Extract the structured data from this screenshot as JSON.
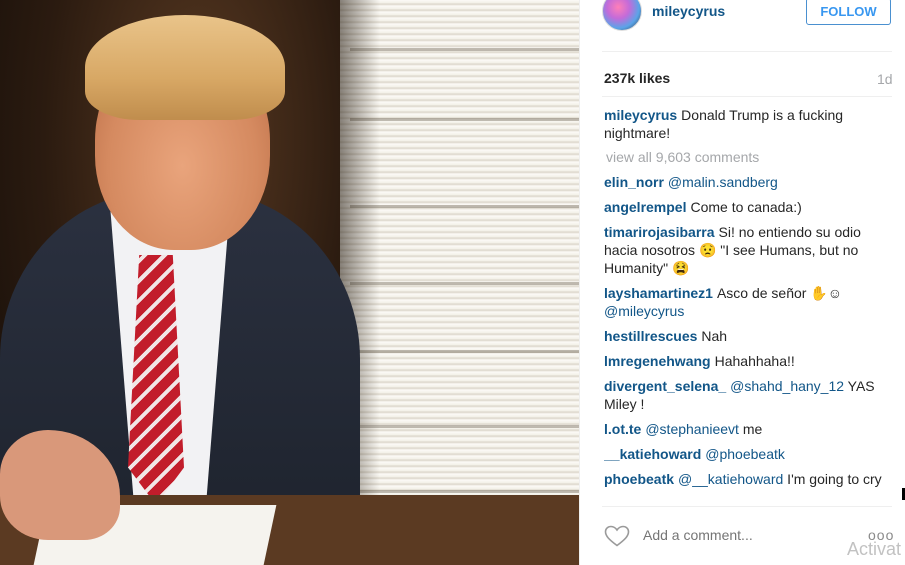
{
  "post": {
    "username": "mileycyrus",
    "follow_label": "FOLLOW",
    "likes": "237k likes",
    "age": "1d",
    "caption": {
      "author": "mileycyrus",
      "text": "Donald Trump is a fucking nightmare!"
    },
    "view_all": "view all 9,603 comments"
  },
  "comments": [
    {
      "author": "elin_norr",
      "parts": [
        {
          "text": "@malin.sandberg",
          "mention": true
        }
      ]
    },
    {
      "author": "angelrempel",
      "parts": [
        {
          "text": "Come to canada:)",
          "mention": false
        }
      ]
    },
    {
      "author": "timarirojasibarra",
      "parts": [
        {
          "text": "Si! no entiendo su odio hacia nosotros 😟 \"I see Humans, but no Humanity\" 😫",
          "mention": false
        }
      ]
    },
    {
      "author": "layshamartinez1",
      "parts": [
        {
          "text": "Asco de señor ✋☺ ",
          "mention": false
        },
        {
          "text": "@mileycyrus",
          "mention": true
        }
      ]
    },
    {
      "author": "hestillrescues",
      "parts": [
        {
          "text": "Nah",
          "mention": false
        }
      ]
    },
    {
      "author": "lmregenehwang",
      "parts": [
        {
          "text": "Hahahhaha!!",
          "mention": false
        }
      ]
    },
    {
      "author": "divergent_selena_",
      "parts": [
        {
          "text": "@shahd_hany_12",
          "mention": true
        },
        {
          "text": " YAS Miley !",
          "mention": false
        }
      ]
    },
    {
      "author": "l.ot.te",
      "parts": [
        {
          "text": "@stephanieevt",
          "mention": true
        },
        {
          "text": " me",
          "mention": false
        }
      ]
    },
    {
      "author": "__katiehoward",
      "parts": [
        {
          "text": "@phoebeatk",
          "mention": true
        }
      ]
    },
    {
      "author": "phoebeatk",
      "parts": [
        {
          "text": "@__katiehoward",
          "mention": true
        },
        {
          "text": " I'm going to cry",
          "mention": false
        }
      ]
    }
  ],
  "footer": {
    "add_comment_placeholder": "Add a comment...",
    "more_label": "ooo",
    "watermark": "Activat",
    "heart_icon": "heart-outline-icon"
  }
}
